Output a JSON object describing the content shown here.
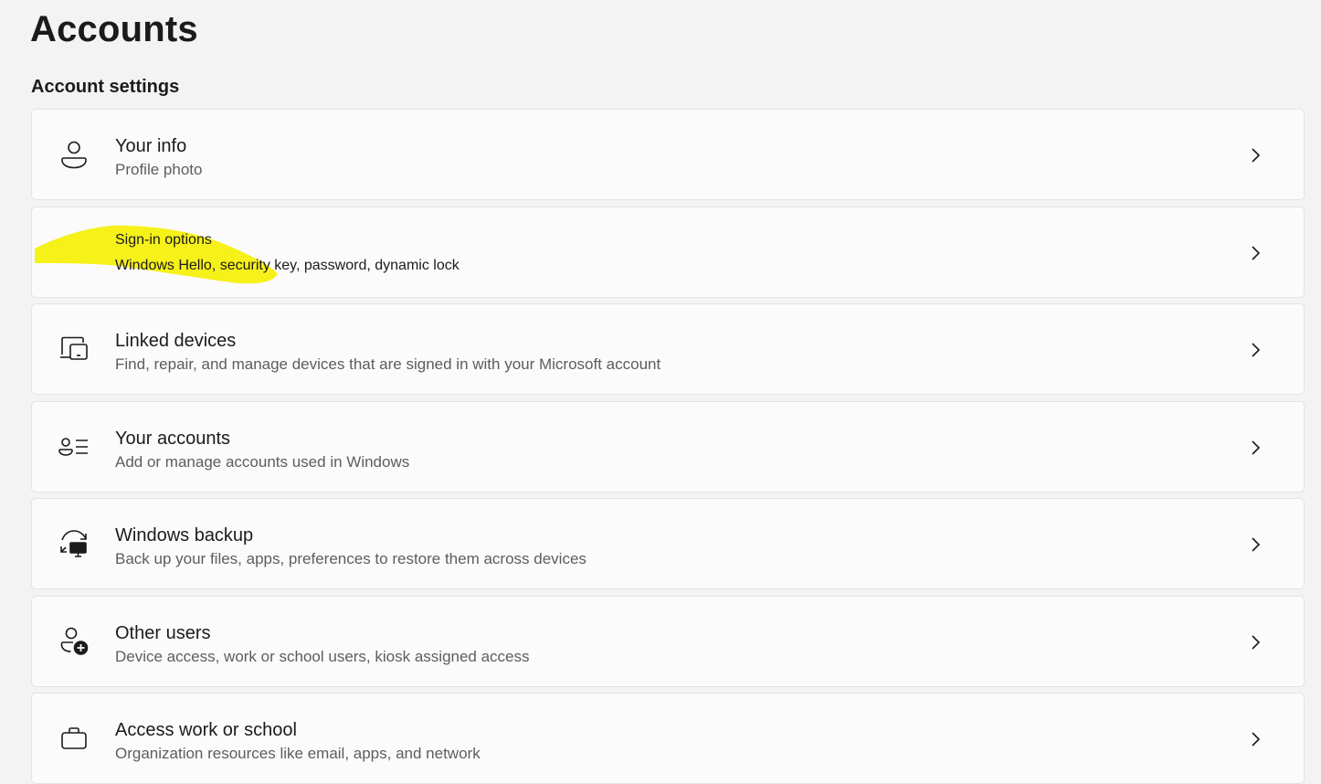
{
  "page": {
    "title": "Accounts",
    "section_title": "Account settings"
  },
  "items": [
    {
      "title": "Your info",
      "description": "Profile photo",
      "icon": "person-icon"
    },
    {
      "title": "Sign-in options",
      "description": "Windows Hello, security key, password, dynamic lock",
      "icon": "key-icon"
    },
    {
      "title": "Linked devices",
      "description": "Find, repair, and manage devices that are signed in with your Microsoft account",
      "icon": "linked-devices-icon"
    },
    {
      "title": "Your accounts",
      "description": "Add or manage accounts used in Windows",
      "icon": "accounts-list-icon"
    },
    {
      "title": "Windows backup",
      "description": "Back up your files, apps, preferences to restore them across devices",
      "icon": "backup-icon"
    },
    {
      "title": "Other users",
      "description": "Device access, work or school users, kiosk assigned access",
      "icon": "add-user-icon"
    },
    {
      "title": "Access work or school",
      "description": "Organization resources like email, apps, and network",
      "icon": "briefcase-icon"
    }
  ],
  "colors": {
    "background": "#f3f3f3",
    "card": "#fbfbfb",
    "highlight": "#f5ef00"
  }
}
